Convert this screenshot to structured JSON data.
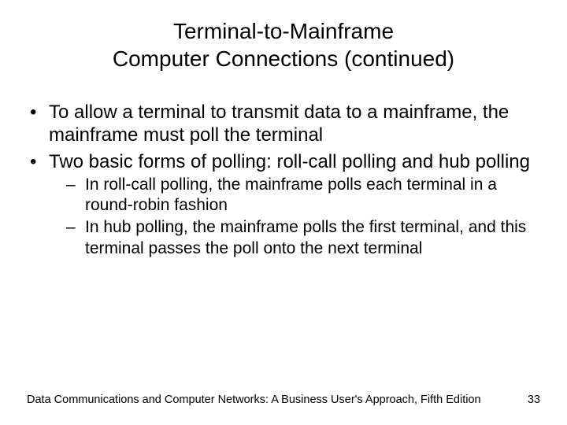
{
  "title": {
    "line1": "Terminal-to-Mainframe",
    "line2": "Computer Connections (continued)"
  },
  "bullets": [
    {
      "text": "To allow a terminal to transmit data to a mainframe, the mainframe must poll the terminal"
    },
    {
      "text": "Two basic forms of polling: roll-call polling and hub polling",
      "sub": [
        "In roll-call polling, the mainframe polls each terminal in a round-robin fashion",
        "In hub polling, the mainframe polls the first terminal, and this terminal passes the poll onto the next terminal"
      ]
    }
  ],
  "footer": {
    "source": "Data Communications and Computer Networks: A Business User's Approach, Fifth Edition",
    "page": "33"
  }
}
